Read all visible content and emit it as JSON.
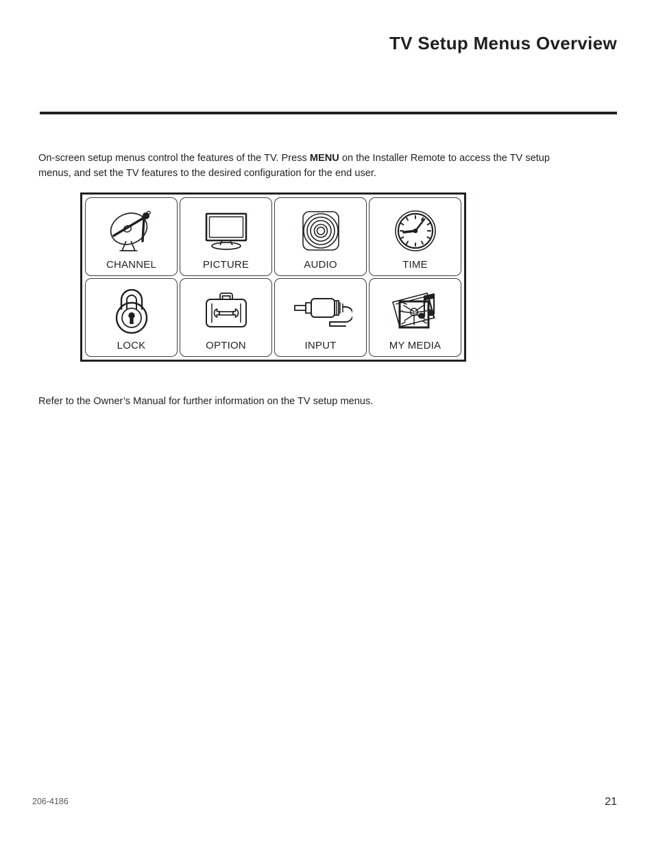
{
  "header": {
    "title": "TV Setup Menus Overview"
  },
  "body": {
    "intro_before_bold": "On-screen setup menus control the features of the TV. Press ",
    "intro_bold": "MENU",
    "intro_after_bold": " on the Installer Remote to access the TV setup menus, and set the TV features to the desired configuration for the end user.",
    "closing": "Refer to the Owner’s Manual for further information on the TV setup menus."
  },
  "menu_grid": {
    "tiles": [
      {
        "label": "CHANNEL",
        "icon": "satellite-dish-icon"
      },
      {
        "label": "PICTURE",
        "icon": "television-icon"
      },
      {
        "label": "AUDIO",
        "icon": "speaker-icon"
      },
      {
        "label": "TIME",
        "icon": "clock-icon"
      },
      {
        "label": "LOCK",
        "icon": "padlock-icon"
      },
      {
        "label": "OPTION",
        "icon": "toolbox-wrench-icon"
      },
      {
        "label": "INPUT",
        "icon": "rca-plug-icon"
      },
      {
        "label": "MY MEDIA",
        "icon": "photos-music-icon"
      }
    ]
  },
  "footer": {
    "document_code": "206-4186",
    "page_number": "21"
  },
  "colors": {
    "ink": "#231f20",
    "line": "#3b3b3d",
    "muted": "#58595b",
    "background": "#ffffff"
  }
}
